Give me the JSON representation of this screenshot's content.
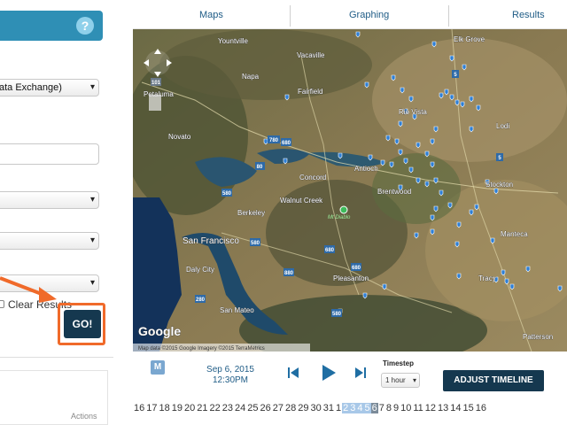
{
  "tabs": [
    "Maps",
    "Graphing",
    "Results"
  ],
  "left_panel": {
    "help_label": "?",
    "select1_value": "ata Exchange)",
    "clear_results_label": "Clear Results",
    "go_label": "GO!",
    "actions_label": "Actions"
  },
  "map": {
    "labels": [
      "Yountville",
      "Vacaville",
      "Elk Grove",
      "Napa",
      "Fairfield",
      "Petaluma",
      "Rio Vista",
      "Lodi",
      "Novato",
      "Antioch",
      "Concord",
      "Brentwood",
      "Stockton",
      "Walnut Creek",
      "Mt Diablo",
      "Berkeley",
      "Manteca",
      "San Francisco",
      "Daly City",
      "Pleasanton",
      "San Mateo",
      "Tracy",
      "Patterson"
    ],
    "highway_shields": [
      "80",
      "780",
      "680",
      "580",
      "580",
      "680",
      "680",
      "580",
      "5",
      "5",
      "880",
      "280",
      "101"
    ],
    "attribution": "Map data ©2015 Google Imagery ©2015 TerraMetrics",
    "google_label": "Google",
    "marker_color": "#2e7fd6"
  },
  "controls": {
    "m_label": "M",
    "date": "Sep 6, 2015",
    "time": "12:30PM",
    "timestep_label": "Timestep",
    "timestep_value": "1 hour",
    "adjust_label": "ADJUST TIMELINE",
    "timeline_numbers": [
      "16",
      "17",
      "18",
      "19",
      "20",
      "21",
      "22",
      "23",
      "24",
      "25",
      "26",
      "27",
      "28",
      "29",
      "30",
      "31",
      "1",
      "2",
      "3",
      "4",
      "5",
      "6",
      "7",
      "8",
      "9",
      "10",
      "11",
      "12",
      "13",
      "14",
      "15",
      "16"
    ],
    "highlighted_range": [
      1,
      5
    ],
    "current_value": "6"
  },
  "colors": {
    "accent": "#2f8fb5",
    "dark_button": "#15384f",
    "callout": "#f06a2a",
    "link": "#1f5c86"
  }
}
